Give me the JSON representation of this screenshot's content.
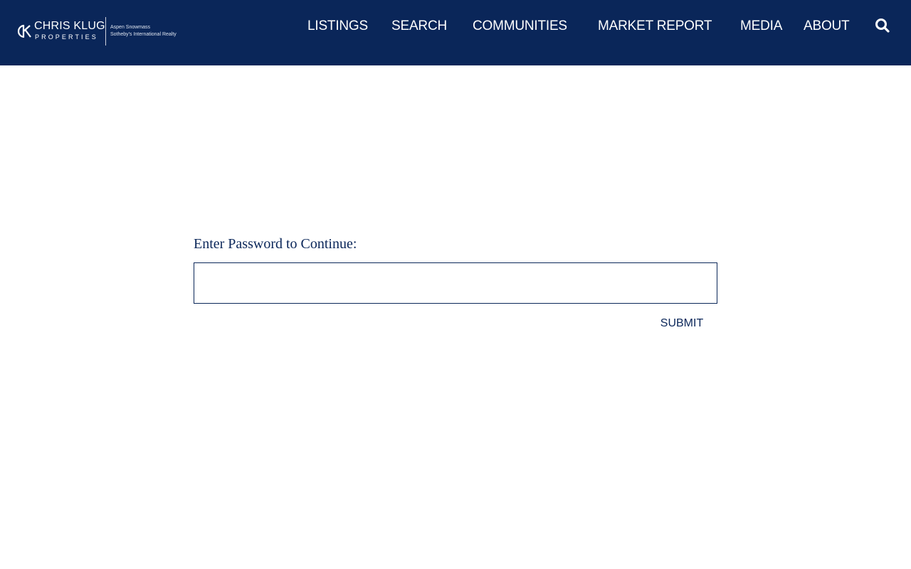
{
  "brand": {
    "name": "CHRIS KLUG",
    "sub": "PROPERTIES",
    "tag_line1": "Aspen Snowmass",
    "tag_line2": "Sotheby's International Realty"
  },
  "nav": {
    "items": [
      {
        "label": "LISTINGS"
      },
      {
        "label": "SEARCH"
      },
      {
        "label": "COMMUNITIES"
      },
      {
        "label": "MARKET REPORT"
      },
      {
        "label": "MEDIA"
      },
      {
        "label": "ABOUT"
      }
    ],
    "search_icon": "search-icon"
  },
  "form": {
    "prompt": "Enter Password to Continue:",
    "password_value": "",
    "submit_label": "SUBMIT"
  },
  "colors": {
    "header_bg": "#0a2659",
    "accent": "#0a2659",
    "page_bg": "#ffffff"
  }
}
